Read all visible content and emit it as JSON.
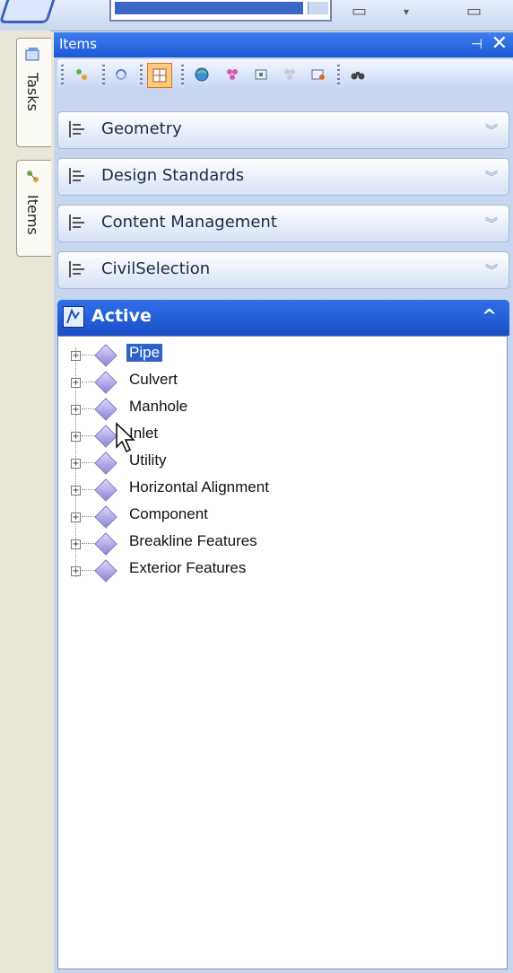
{
  "panel": {
    "title": "Items"
  },
  "tabs": [
    {
      "label": "Tasks"
    },
    {
      "label": "Items"
    }
  ],
  "toolbar": {
    "icons": [
      "item-types-icon",
      "refresh-icon",
      "grid-view-icon",
      "globe-icon",
      "multi-select-icon",
      "frame-icon",
      "filter-icon",
      "settings-icon",
      "find-icon"
    ],
    "active": "grid-view-icon"
  },
  "sections": [
    {
      "label": "Geometry",
      "expanded": false
    },
    {
      "label": "Design Standards",
      "expanded": false
    },
    {
      "label": "Content Management",
      "expanded": false
    },
    {
      "label": "CivilSelection",
      "expanded": false
    }
  ],
  "active": {
    "label": "Active",
    "expanded": true
  },
  "tree": {
    "items": [
      {
        "label": "Pipe",
        "selected": true
      },
      {
        "label": "Culvert",
        "selected": false
      },
      {
        "label": "Manhole",
        "selected": false
      },
      {
        "label": "Inlet",
        "selected": false
      },
      {
        "label": "Utility",
        "selected": false
      },
      {
        "label": "Horizontal Alignment",
        "selected": false
      },
      {
        "label": "Component",
        "selected": false
      },
      {
        "label": "Breakline Features",
        "selected": false
      },
      {
        "label": "Exterior Features",
        "selected": false
      }
    ]
  },
  "colors": {
    "accent": "#1e58d6",
    "selection": "#2f62c8",
    "toolbar_active": "#ffc880"
  }
}
